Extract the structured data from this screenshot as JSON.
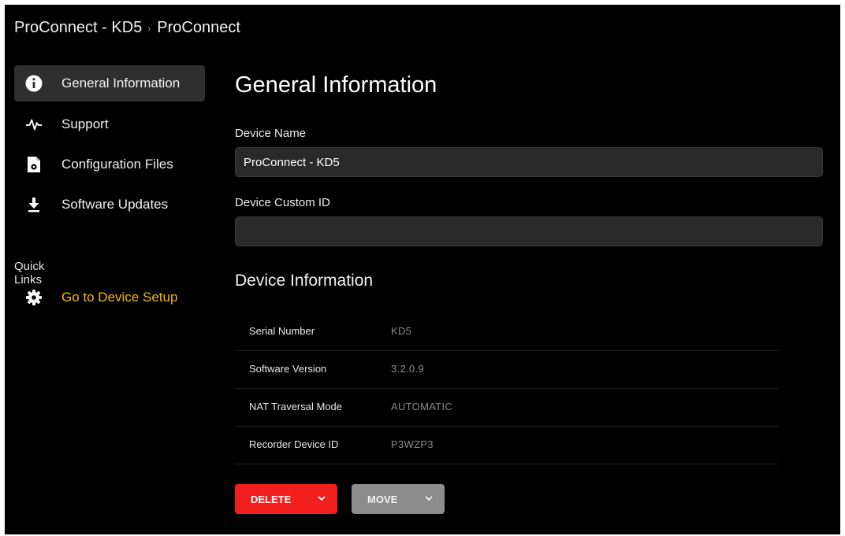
{
  "header": {
    "device_title": "ProConnect - KD5",
    "separator_icon": "chevron-right-icon",
    "crumb": "ProConnect"
  },
  "sidebar": {
    "items": [
      {
        "label": "General Information",
        "icon": "info-icon",
        "active": true
      },
      {
        "label": "Support",
        "icon": "pulse-icon",
        "active": false
      },
      {
        "label": "Configuration Files",
        "icon": "config-file-icon",
        "active": false
      },
      {
        "label": "Software Updates",
        "icon": "download-icon",
        "active": false
      }
    ],
    "quick_links_title": "Quick Links",
    "quick_links": [
      {
        "label": "Go to Device Setup",
        "icon": "gear-icon"
      }
    ]
  },
  "main": {
    "title": "General Information",
    "device_name_label": "Device Name",
    "device_name_value": "ProConnect - KD5",
    "custom_id_label": "Device Custom ID",
    "custom_id_value": "",
    "device_info_title": "Device Information",
    "info_rows": [
      {
        "key": "Serial Number",
        "value": "KD5"
      },
      {
        "key": "Software Version",
        "value": "3.2.0.9"
      },
      {
        "key": "NAT Traversal Mode",
        "value": "AUTOMATIC"
      },
      {
        "key": "Recorder Device ID",
        "value": "P3WZP3"
      }
    ]
  },
  "buttons": {
    "delete_label": "DELETE",
    "move_label": "MOVE"
  },
  "colors": {
    "background": "#000000",
    "active_item": "#2f2f2f",
    "quick_link": "#f5b800",
    "delete": "#f21f1f",
    "move": "#8c8c8c"
  }
}
